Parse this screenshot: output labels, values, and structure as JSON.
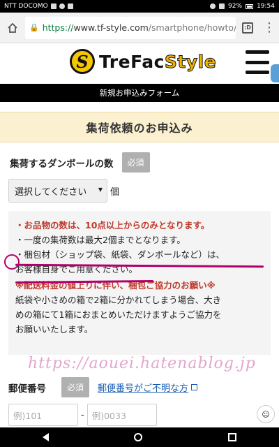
{
  "statusbar": {
    "carrier": "NTT DOCOMO",
    "battery": "92%",
    "time": "19:54"
  },
  "browser": {
    "url_scheme": "https://",
    "url_host": "www.tf-style.com",
    "url_path": "/smartphone/howto/pos",
    "tabs_count": ":D"
  },
  "site": {
    "logo_text_a": "TreFac",
    "logo_text_b": "Style",
    "logo_letter": "S",
    "banner": "新規お申込みフォーム"
  },
  "form": {
    "section_title": "集荷依頼のお申込み",
    "box_count_label": "集荷するダンボールの数",
    "required_label": "必須",
    "select_value": "選択してください",
    "unit": "個",
    "notices": [
      "・お品物の数は、10点以上からのみとなります。",
      "・一度の集荷数は最大2個までとなります。",
      "・梱包材（ショップ袋、紙袋、ダンボールなど）は、",
      "お客様自身でご用意ください。"
    ],
    "notice_header": "※配送料金の値上りに伴い、梱包ご協力のお願い※",
    "notice_body": [
      "紙袋や小さめの箱で2箱に分かれてしまう場合、大き",
      "めの箱にて1箱におまとめいただけますようご協力を",
      "お願いいたします。"
    ],
    "postal_label": "郵便番号",
    "postal_required": "必須",
    "postal_link": "郵便番号がご不明な方",
    "postal_placeholder_1": "例)101",
    "postal_placeholder_2": "例)0033",
    "postal_dash": "-"
  },
  "watermark": "https://aouei.hatenablog.jp",
  "colors": {
    "banner_bg": "#000000",
    "section_bg": "#fbf0cf",
    "notice_red": "#c0392b",
    "link_blue": "#1a5fb4",
    "annotation": "#b0006a"
  }
}
